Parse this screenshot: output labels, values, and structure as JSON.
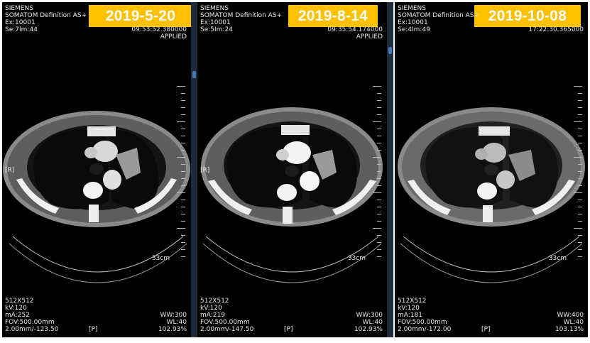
{
  "panels": [
    {
      "date": "2019-5-20",
      "top_left": [
        "SIEMENS",
        "SOMATOM Definition AS+",
        "Ex:10001",
        "Se:7Im:44"
      ],
      "top_right": [
        "09:53:52.380000",
        "APPLIED"
      ],
      "orientation_left": "[R]",
      "orientation_bottom": "[P]",
      "scale": "33cm",
      "bottom_left": [
        "512X512",
        "kV:120",
        "mA:252",
        "FOV:500.00mm",
        "2.00mm/-123.50"
      ],
      "bottom_right": [
        "WW:300",
        "WL:40",
        "102.93%"
      ]
    },
    {
      "date": "2019-8-14",
      "top_left": [
        "SIEMENS",
        "SOMATOM Definition AS+",
        "Ex:10001",
        "Se:5Im:24"
      ],
      "top_right": [
        "09:35:54.174000",
        "APPLIED"
      ],
      "orientation_left": "[R]",
      "orientation_bottom": "[P]",
      "scale": "33cm",
      "bottom_left": [
        "512X512",
        "kV:120",
        "mA:219",
        "FOV:500.00mm",
        "2.00mm/-147.50"
      ],
      "bottom_right": [
        "WW:300",
        "WL:40",
        "102.93%"
      ]
    },
    {
      "date": "2019-10-08",
      "top_left": [
        "SIEMENS",
        "SOMATOM Definition AS+",
        "Ex:10001",
        "Se:4Im:49"
      ],
      "top_right": [
        "17:22:30.365000"
      ],
      "orientation_left": "",
      "orientation_bottom": "[P]",
      "scale": "33cm",
      "bottom_left": [
        "512X512",
        "kV:120",
        "mA:181",
        "FOV:500.00mm",
        "2.00mm/-172.00"
      ],
      "bottom_right": [
        "WW:400",
        "WL:40",
        "103.13%"
      ]
    }
  ],
  "colors": {
    "badge": "#ffc000",
    "badge_text": "#ffffff",
    "overlay_text": "#e8e8e8",
    "scroll_thumb": "#4a79b8",
    "separator": "#1e2b3a"
  }
}
